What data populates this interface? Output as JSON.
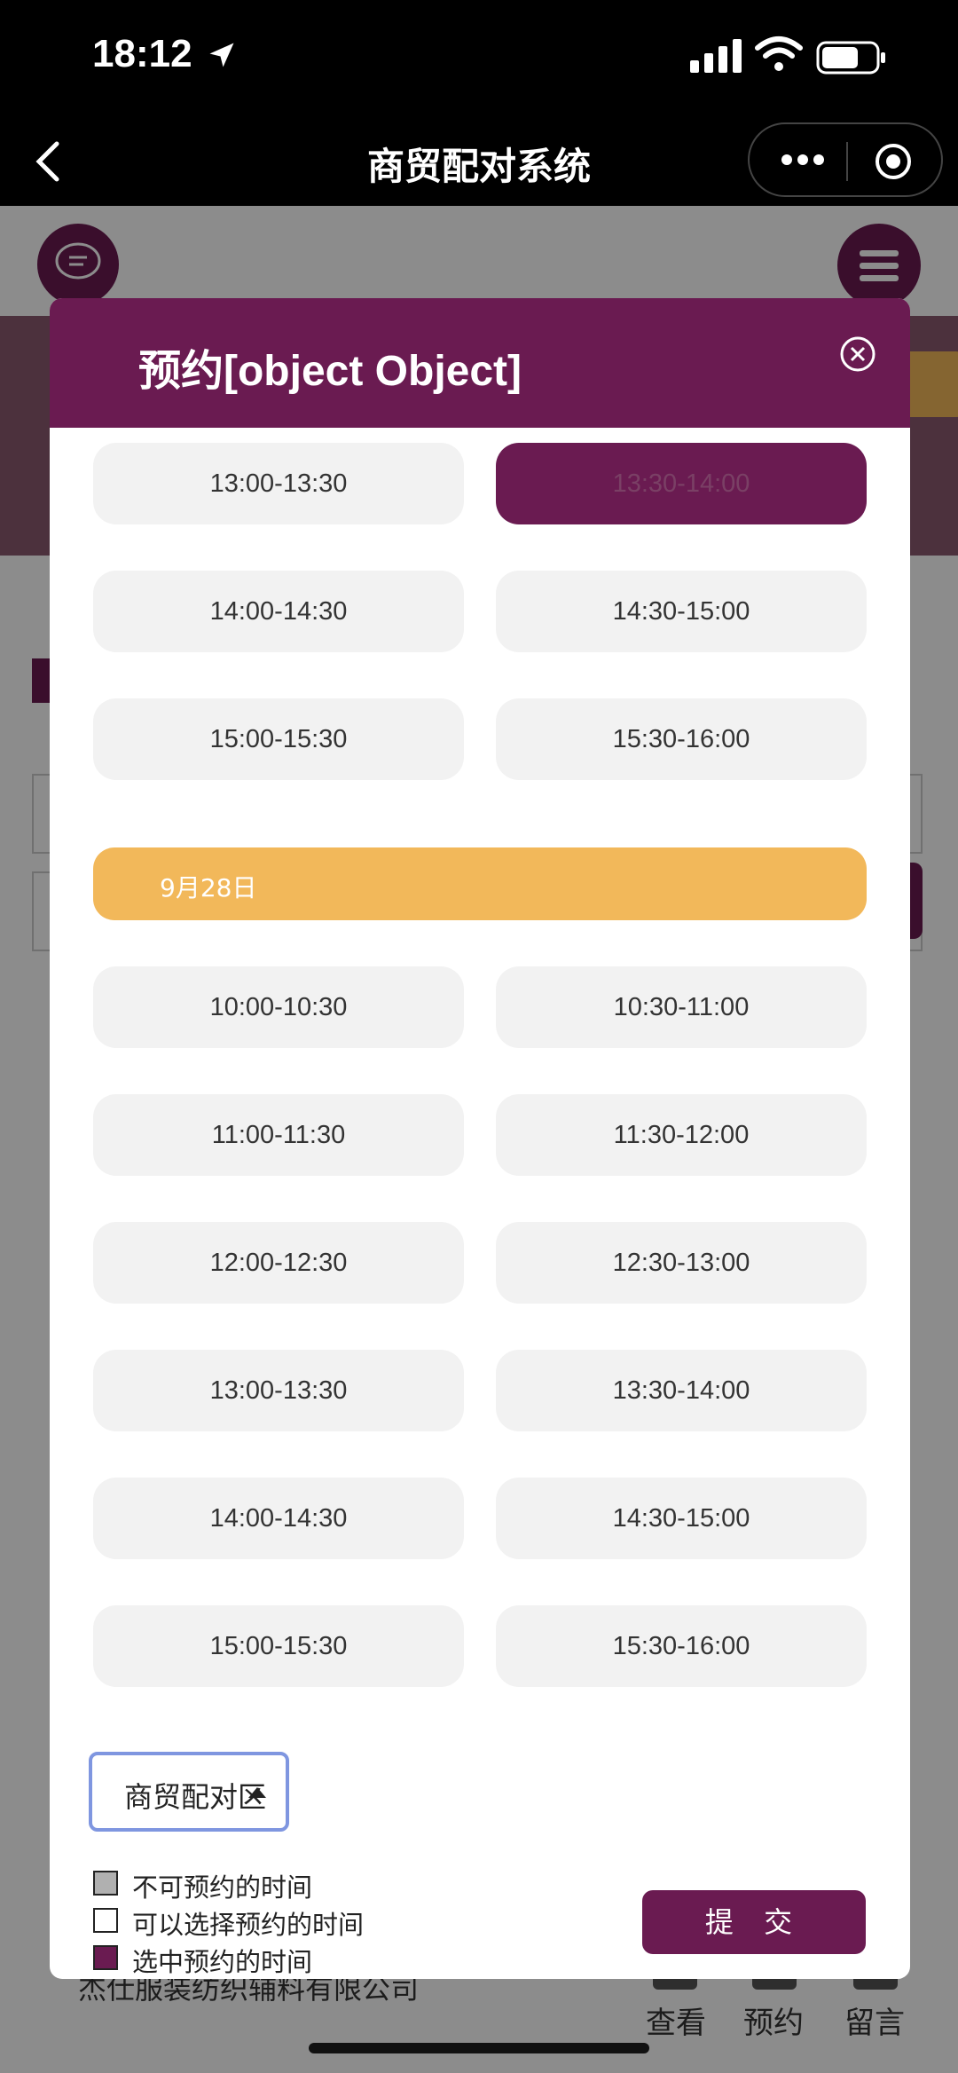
{
  "status_bar": {
    "time": "18:12"
  },
  "nav": {
    "title": "商贸配对系统"
  },
  "background_page": {
    "company": "杰仕服装纺织辅料有限公司",
    "tabs": [
      {
        "label": "查看"
      },
      {
        "label": "预约"
      },
      {
        "label": "留言"
      }
    ]
  },
  "modal": {
    "title": "预约[object Object]",
    "slots_top": [
      {
        "label": "13:00-13:30",
        "state": "available"
      },
      {
        "label": "13:30-14:00",
        "state": "selected"
      },
      {
        "label": "14:00-14:30",
        "state": "available"
      },
      {
        "label": "14:30-15:00",
        "state": "available"
      },
      {
        "label": "15:00-15:30",
        "state": "available"
      },
      {
        "label": "15:30-16:00",
        "state": "available"
      }
    ],
    "date": {
      "label": "9月28日"
    },
    "slots": [
      {
        "label": "10:00-10:30"
      },
      {
        "label": "10:30-11:00"
      },
      {
        "label": "11:00-11:30"
      },
      {
        "label": "11:30-12:00"
      },
      {
        "label": "12:00-12:30"
      },
      {
        "label": "12:30-13:00"
      },
      {
        "label": "13:00-13:30"
      },
      {
        "label": "13:30-14:00"
      },
      {
        "label": "14:00-14:30"
      },
      {
        "label": "14:30-15:00"
      },
      {
        "label": "15:00-15:30"
      },
      {
        "label": "15:30-16:00"
      }
    ],
    "area_select": {
      "value": "商贸配对区"
    },
    "legend": [
      {
        "label": "不可预约的时间",
        "color": "#b0b0b0"
      },
      {
        "label": "可以选择预约的时间",
        "color": "#ffffff"
      },
      {
        "label": "选中预约的时间",
        "color": "#6a1b51"
      }
    ],
    "submit_label": "提 交"
  },
  "colors": {
    "brand": "#6a1b51",
    "date_bar": "#f2b85a",
    "slot_bg": "#f2f2f2"
  }
}
